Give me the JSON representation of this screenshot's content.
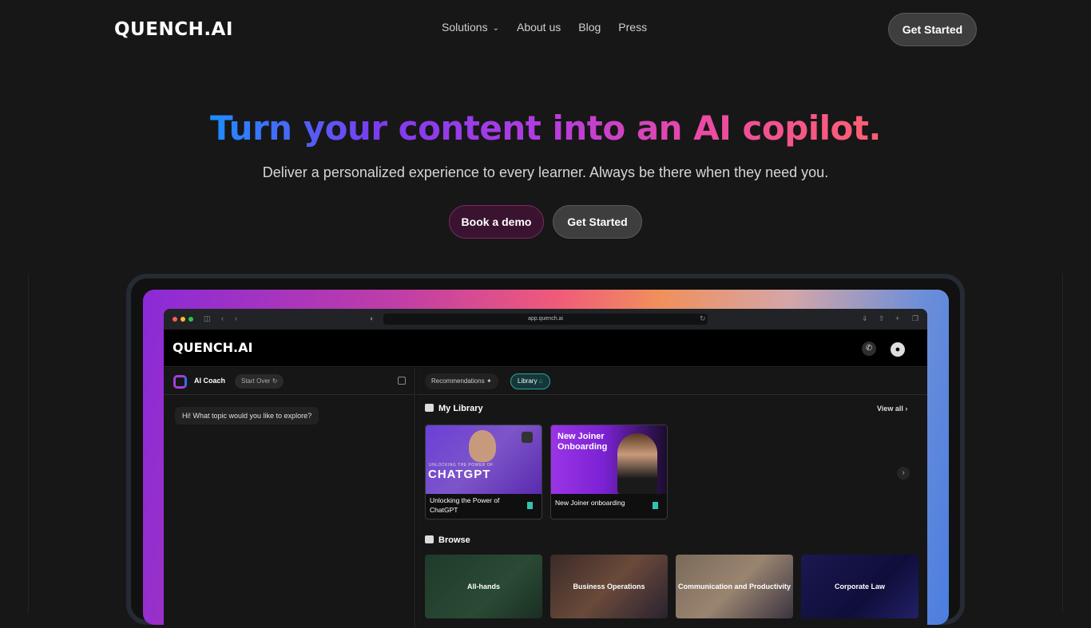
{
  "nav": {
    "logo": "QUENCH.AI",
    "items": [
      "Solutions",
      "About us",
      "Blog",
      "Press"
    ],
    "cta": "Get Started"
  },
  "hero": {
    "title": "Turn your content into an AI copilot.",
    "subtitle": "Deliver a personalized experience to every learner. Always be there when they need you.",
    "btn_demo": "Book a demo",
    "btn_start": "Get Started"
  },
  "browser": {
    "url": "app.quench.ai"
  },
  "app": {
    "logo": "QUENCH.AI",
    "coach_label": "AI Coach",
    "start_over": "Start Over",
    "greeting": "Hi! What topic would you like to explore?",
    "tab_recommendations": "Recommendations",
    "tab_library": "Library",
    "my_library": "My Library",
    "view_all": "View all",
    "browse": "Browse",
    "library_cards": [
      {
        "image_small": "UNLOCKING THE POWER OF",
        "image_title": "CHATGPT",
        "caption": "Unlocking the Power of ChatGPT"
      },
      {
        "image_title": "New Joiner Onboarding",
        "caption": "New Joiner onboarding"
      }
    ],
    "browse_cards": [
      "All-hands",
      "Business Operations",
      "Communication and Productivity",
      "Corporate Law"
    ]
  },
  "colors": {
    "accent_teal": "#34c2b0",
    "gradient_blue": "#1c8dff",
    "gradient_purple": "#b33cdf",
    "gradient_pink": "#ff6070"
  }
}
